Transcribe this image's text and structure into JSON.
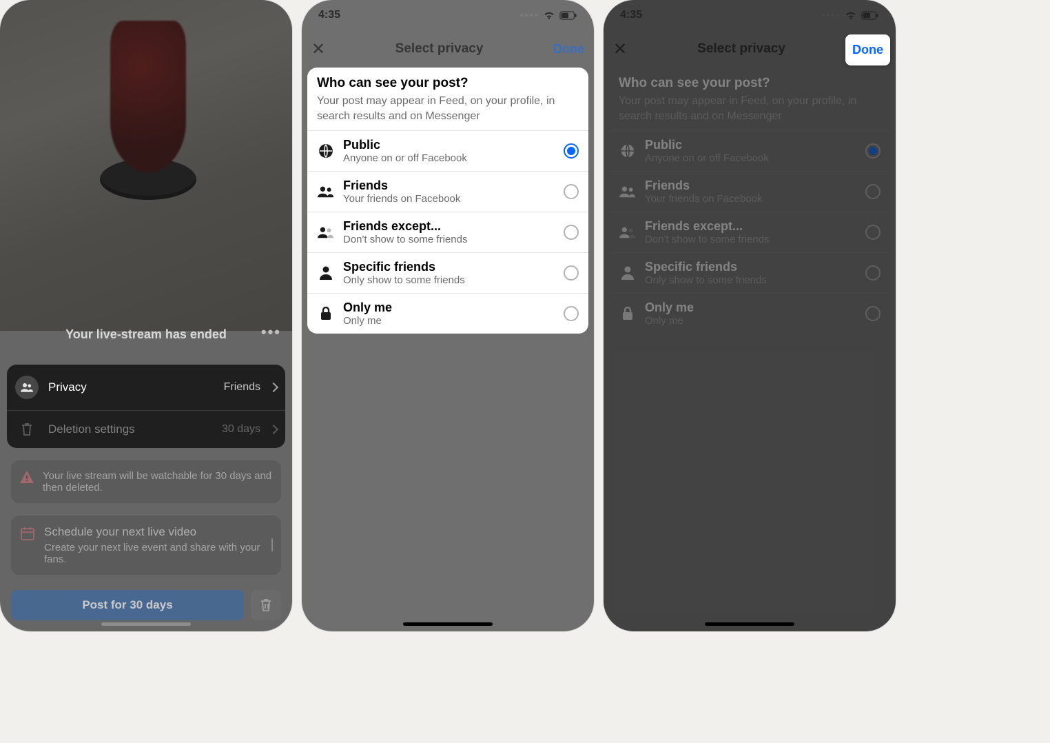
{
  "status": {
    "time": "4:35"
  },
  "screen1": {
    "header": "Your live-stream has ended",
    "privacy": {
      "label": "Privacy",
      "value": "Friends"
    },
    "deletion": {
      "label": "Deletion settings",
      "value": "30 days"
    },
    "notice": "Your live stream will be watchable for 30 days and then deleted.",
    "schedule": {
      "title": "Schedule your next live video",
      "desc": "Create your next live event and share with your fans."
    },
    "post_button": "Post for 30 days"
  },
  "privacy_sheet": {
    "title": "Select privacy",
    "done": "Done",
    "question": "Who can see your post?",
    "subtitle": "Your post may appear in Feed, on your profile, in search results and on Messenger",
    "options": [
      {
        "label": "Public",
        "desc": "Anyone on or off Facebook",
        "selected": true
      },
      {
        "label": "Friends",
        "desc": "Your friends on Facebook",
        "selected": false
      },
      {
        "label": "Friends except...",
        "desc": "Don't show to some friends",
        "selected": false
      },
      {
        "label": "Specific friends",
        "desc": "Only show to some friends",
        "selected": false
      },
      {
        "label": "Only me",
        "desc": "Only me",
        "selected": false
      }
    ]
  }
}
